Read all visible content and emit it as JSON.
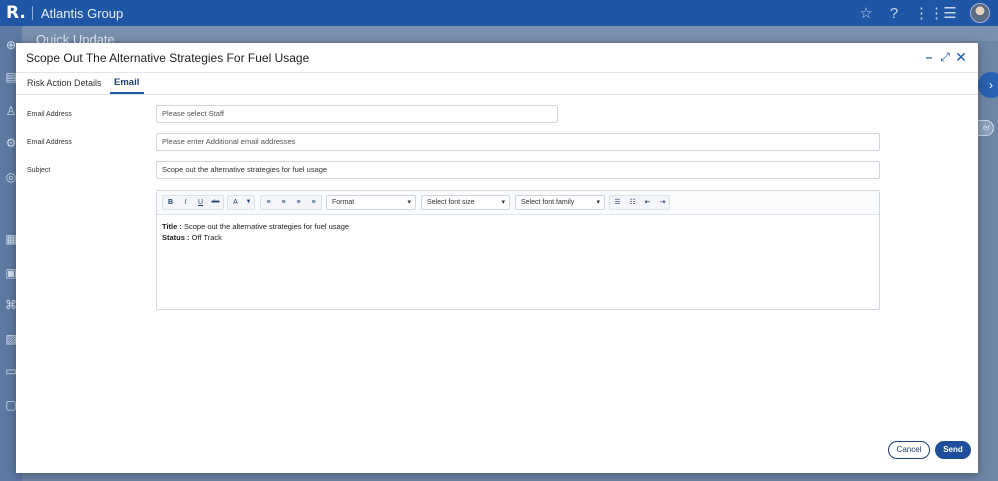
{
  "app": {
    "logo": "R.",
    "org_name": "Atlantis Group",
    "icons": [
      "star-icon",
      "help-icon",
      "apps-grid-icon",
      "menu-icon",
      "avatar"
    ]
  },
  "background": {
    "page_title": "Quick Update"
  },
  "modal": {
    "title": "Scope Out The Alternative Strategies For Fuel Usage",
    "controls": {
      "minimize": "–",
      "maximize": "⤢",
      "close": "✕"
    },
    "tabs": [
      {
        "label": "Risk Action Details",
        "active": false
      },
      {
        "label": "Email",
        "active": true
      }
    ],
    "form": {
      "staff_label": "Email Address",
      "staff_placeholder": "Please select Staff",
      "additional_label": "Email Address",
      "additional_placeholder": "Please enter Additional email addresses",
      "subject_label": "Subject",
      "subject_value": "Scope out the alternative strategies for fuel usage"
    },
    "editor": {
      "toolbar": {
        "bold": "B",
        "italic": "I",
        "underline": "U",
        "strike": "abc",
        "font_color": "A",
        "format_select": "Format",
        "font_size_select": "Select font size",
        "font_family_select": "Select font family"
      },
      "body": {
        "title_label": "Title :",
        "title_value": "Scope out the alternative strategies for fuel usage",
        "status_label": "Status :",
        "status_value": "Off Track"
      }
    },
    "buttons": {
      "cancel": "Cancel",
      "send": "Send"
    }
  }
}
